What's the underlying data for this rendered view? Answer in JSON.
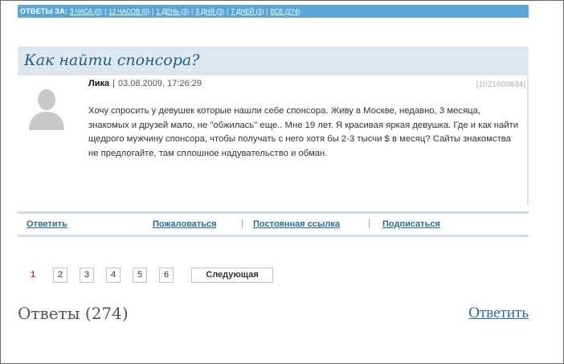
{
  "filters": {
    "lead": "ОТВЕТЫ ЗА:",
    "items": [
      "3 ЧАСА (0)",
      "12 ЧАСОВ (0)",
      "1 ДЕНЬ (3)",
      "3 ДНЯ (3)",
      "7 ДНЕЙ (3)",
      "ВСЕ (274)"
    ]
  },
  "question": {
    "title": "Как найти спонсора?",
    "author": "Лика",
    "separator": "|",
    "date": "03.08.2009, 17:26:29",
    "id": "[1021600834]",
    "body": "Хочу спросить у девушек которые нашли себе спонсора. Живу в Москве, недавно, 3 месяца, знакомых и друзей мало, не \"обжилась\" еще.. Мне 19 лет. Я красивая яркая девушка. Где и как найти щедрого мужчину спонсора, чтобы получать с него хотя бы 2-3 тысчи $ в месяц? Сайты знакомства не предлогайте, там сплошное надувательство и обман."
  },
  "actions": {
    "reply": "Ответить",
    "report": "Пожаловаться",
    "permalink": "Постоянная ссылка",
    "subscribe": "Подписаться",
    "separator": "|"
  },
  "pagination": {
    "current": "1",
    "pages": [
      "2",
      "3",
      "4",
      "5",
      "6"
    ],
    "next": "Следующая"
  },
  "answers": {
    "heading": "Ответы (274)",
    "reply_link": "Ответить"
  },
  "colors": {
    "filter_bar": "#5ba6d6",
    "title_bg": "#dde7ed",
    "title_text": "#1f5f88",
    "link": "#2a6a9a",
    "current_page": "#c0392b"
  },
  "icons": {
    "avatar": "user-silhouette-icon"
  }
}
